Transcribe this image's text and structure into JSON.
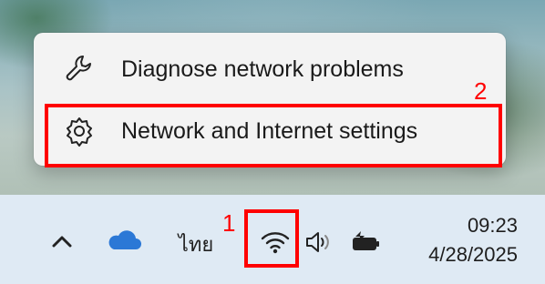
{
  "menu": {
    "items": [
      {
        "label": "Diagnose network problems",
        "icon": "wrench-icon"
      },
      {
        "label": "Network and Internet settings",
        "icon": "gear-icon"
      }
    ]
  },
  "taskbar": {
    "language": "ไทย",
    "time": "09:23",
    "date": "4/28/2025",
    "icons": [
      "chevron-up-icon",
      "onedrive-cloud-icon",
      "wifi-icon",
      "speaker-icon",
      "battery-charging-icon"
    ]
  },
  "annotations": {
    "step1": "1",
    "step2": "2"
  },
  "colors": {
    "annotation": "#ff0000",
    "taskbar_bg": "#dfeaf4",
    "menu_bg": "#f3f3f3",
    "onedrive": "#2b78d6"
  }
}
